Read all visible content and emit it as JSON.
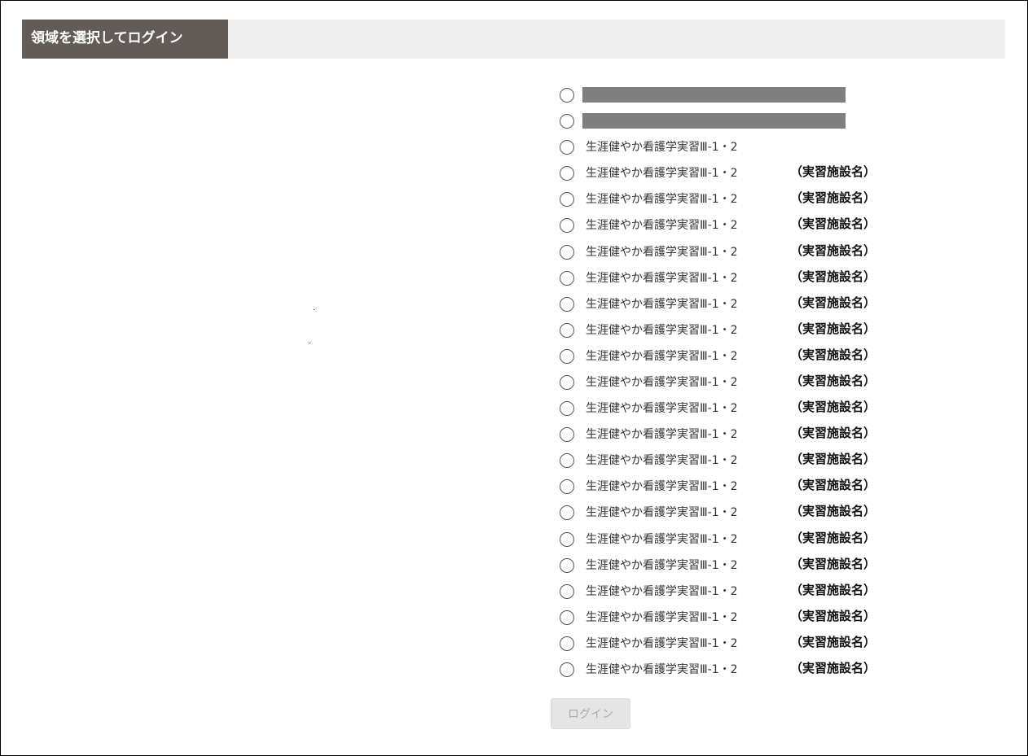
{
  "header": {
    "title": "領域を選択してログイン"
  },
  "options": [
    {
      "redacted": true,
      "label": "",
      "facility": ""
    },
    {
      "redacted": true,
      "label": "",
      "facility": ""
    },
    {
      "redacted": false,
      "label": "生涯健やか看護学実習Ⅲ-1・2",
      "facility": ""
    },
    {
      "redacted": false,
      "label": "生涯健やか看護学実習Ⅲ-1・2",
      "facility": "（実習施設名）"
    },
    {
      "redacted": false,
      "label": "生涯健やか看護学実習Ⅲ-1・2",
      "facility": "（実習施設名）"
    },
    {
      "redacted": false,
      "label": "生涯健やか看護学実習Ⅲ-1・2",
      "facility": "（実習施設名）"
    },
    {
      "redacted": false,
      "label": "生涯健やか看護学実習Ⅲ-1・2",
      "facility": "（実習施設名）"
    },
    {
      "redacted": false,
      "label": "生涯健やか看護学実習Ⅲ-1・2",
      "facility": "（実習施設名）"
    },
    {
      "redacted": false,
      "label": "生涯健やか看護学実習Ⅲ-1・2",
      "facility": "（実習施設名）"
    },
    {
      "redacted": false,
      "label": "生涯健やか看護学実習Ⅲ-1・2",
      "facility": "（実習施設名）"
    },
    {
      "redacted": false,
      "label": "生涯健やか看護学実習Ⅲ-1・2",
      "facility": "（実習施設名）"
    },
    {
      "redacted": false,
      "label": "生涯健やか看護学実習Ⅲ-1・2",
      "facility": "（実習施設名）"
    },
    {
      "redacted": false,
      "label": "生涯健やか看護学実習Ⅲ-1・2",
      "facility": "（実習施設名）"
    },
    {
      "redacted": false,
      "label": "生涯健やか看護学実習Ⅲ-1・2",
      "facility": "（実習施設名）"
    },
    {
      "redacted": false,
      "label": "生涯健やか看護学実習Ⅲ-1・2",
      "facility": "（実習施設名）"
    },
    {
      "redacted": false,
      "label": "生涯健やか看護学実習Ⅲ-1・2",
      "facility": "（実習施設名）"
    },
    {
      "redacted": false,
      "label": "生涯健やか看護学実習Ⅲ-1・2",
      "facility": "（実習施設名）"
    },
    {
      "redacted": false,
      "label": "生涯健やか看護学実習Ⅲ-1・2",
      "facility": "（実習施設名）"
    },
    {
      "redacted": false,
      "label": "生涯健やか看護学実習Ⅲ-1・2",
      "facility": "（実習施設名）"
    },
    {
      "redacted": false,
      "label": "生涯健やか看護学実習Ⅲ-1・2",
      "facility": "（実習施設名）"
    },
    {
      "redacted": false,
      "label": "生涯健やか看護学実習Ⅲ-1・2",
      "facility": "（実習施設名）"
    },
    {
      "redacted": false,
      "label": "生涯健やか看護学実習Ⅲ-1・2",
      "facility": "（実習施設名）"
    },
    {
      "redacted": false,
      "label": "生涯健やか看護学実習Ⅲ-1・2",
      "facility": "（実習施設名）"
    }
  ],
  "login_button": {
    "label": "ログイン",
    "enabled": false
  },
  "colors": {
    "header_title_bg": "#625b57",
    "header_bar_bg": "#efefef",
    "redacted_bar": "#7f7f7f",
    "button_bg": "#e5e5e5",
    "button_text": "#aaaaaa"
  }
}
